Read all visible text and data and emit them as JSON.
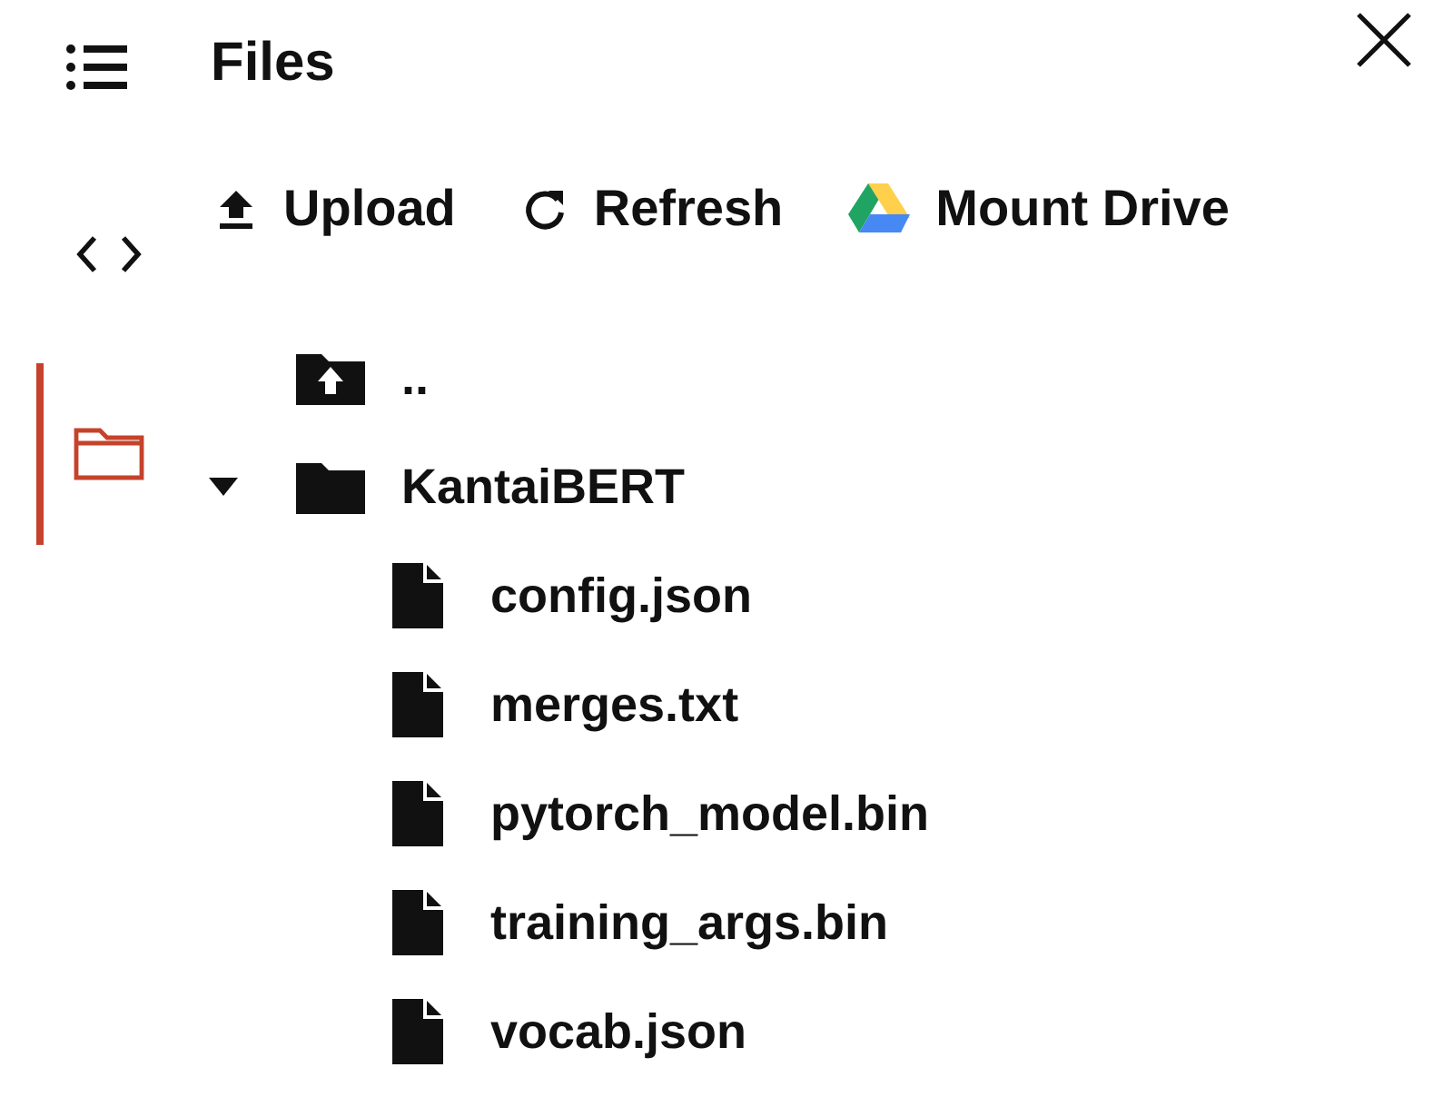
{
  "panel": {
    "title": "Files"
  },
  "rail": [
    {
      "kind": "code",
      "selected": false
    },
    {
      "kind": "files",
      "selected": true
    }
  ],
  "toolbar": [
    {
      "kind": "upload",
      "label": "Upload"
    },
    {
      "kind": "refresh",
      "label": "Refresh"
    },
    {
      "kind": "drive",
      "label": "Mount Drive"
    }
  ],
  "tree": [
    {
      "kind": "parent",
      "name": ".."
    },
    {
      "kind": "folder",
      "name": "KantaiBERT",
      "expanded": true,
      "children": [
        {
          "kind": "file",
          "name": "config.json"
        },
        {
          "kind": "file",
          "name": "merges.txt"
        },
        {
          "kind": "file",
          "name": "pytorch_model.bin"
        },
        {
          "kind": "file",
          "name": "training_args.bin"
        },
        {
          "kind": "file",
          "name": "vocab.json"
        }
      ]
    }
  ]
}
